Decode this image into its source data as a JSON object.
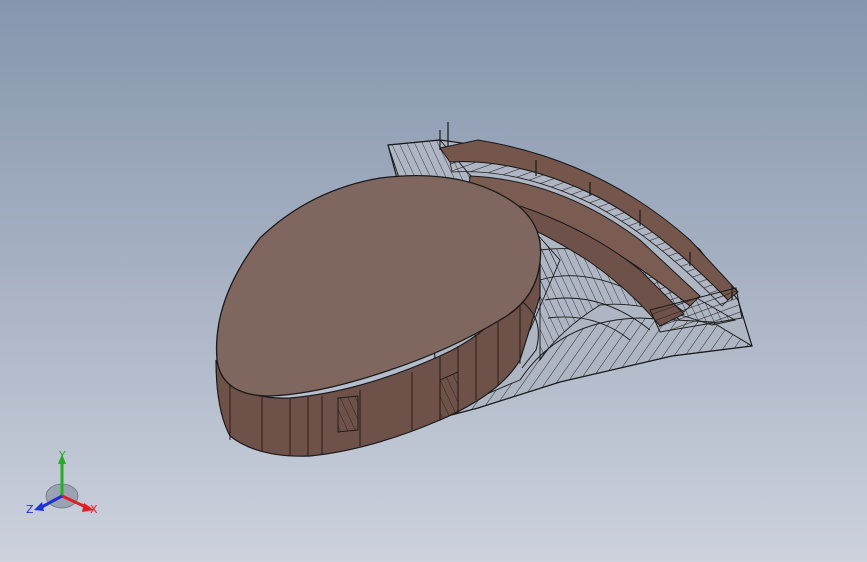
{
  "view": {
    "background_top": "#8696ae",
    "background_bottom": "#cdd2dd"
  },
  "model": {
    "roof_color": "#7f665e",
    "wall_color": "#6e5148",
    "deck_color": "#74564c",
    "edge_color": "#1a1a1a",
    "surface_color": "#aab2c0"
  },
  "triad": {
    "x_label": "X",
    "y_label": "Y",
    "z_label": "Z",
    "x_color": "#e02020",
    "y_color": "#22b022",
    "z_color": "#2030d8"
  }
}
